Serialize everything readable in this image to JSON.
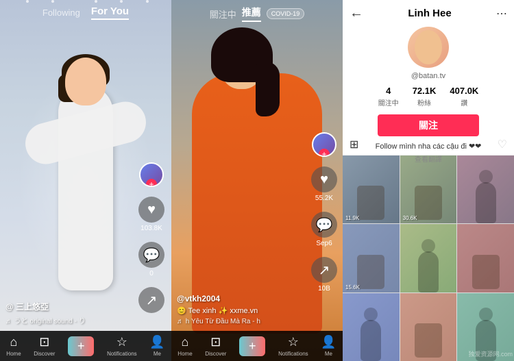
{
  "left": {
    "nav": {
      "following": "Following",
      "for_you": "For You"
    },
    "side_actions": {
      "like_count": "103.8K",
      "comment_count": "0"
    },
    "bottom_info": {
      "username": "@ 三上悠亞",
      "music": "♬ うと  original sound - り"
    },
    "bottom_nav": {
      "home": "Home",
      "discover": "Discover",
      "add": "+",
      "notifications": "Notifications",
      "me": "Me"
    }
  },
  "middle": {
    "nav": {
      "following": "關注中",
      "for_you": "推薦",
      "covid": "COVID-19"
    },
    "side_actions": {
      "like_count": "55.2K",
      "comment_count": "Sep6",
      "share_count": "10B"
    },
    "bottom_info": {
      "username": "@vtkh2004",
      "desc": "😊 Tee xinh ✨ xxme.vn",
      "music": "♬ h  Yêu Từ Đầu Mà Ra - h"
    },
    "bottom_nav": {
      "home": "Home",
      "discover": "Discover",
      "add": "+",
      "notifications": "Notifications",
      "me": "Me"
    }
  },
  "right": {
    "profile": {
      "name": "Linh Hee",
      "handle": "@batan.tv",
      "stats": {
        "following": "4",
        "following_label": "關注中",
        "followers": "72.1K",
        "followers_label": "粉絲",
        "likes": "407.0K",
        "likes_label": "讚"
      },
      "follow_btn": "關注",
      "bio": "Follow mình nha các cậu đi ❤❤",
      "translate": "查看翻譯"
    },
    "videos_header": {
      "grid_icon": "⊞",
      "heart_icon": "♡"
    },
    "video_thumbs": [
      {
        "play_count": "11.9K"
      },
      {
        "play_count": "30.6K"
      },
      {
        "play_count": ""
      },
      {
        "play_count": "15.6K"
      },
      {
        "play_count": ""
      },
      {
        "play_count": ""
      },
      {
        "play_count": ""
      },
      {
        "play_count": ""
      },
      {
        "play_count": ""
      }
    ]
  },
  "watermark": "独爱资源网.com"
}
